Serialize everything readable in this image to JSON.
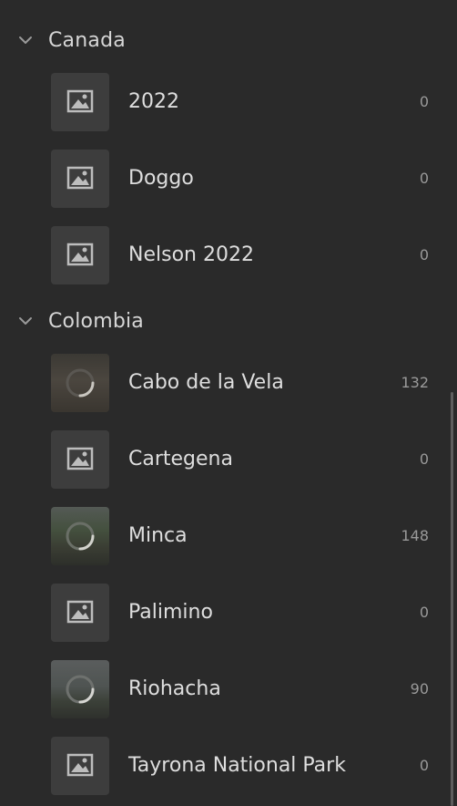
{
  "groups": [
    {
      "name": "Canada",
      "albums": [
        {
          "name": "2022",
          "count": "0",
          "thumb": "placeholder-image-icon"
        },
        {
          "name": "Doggo",
          "count": "0",
          "thumb": "placeholder-image-icon"
        },
        {
          "name": "Nelson 2022",
          "count": "0",
          "thumb": "placeholder-image-icon"
        }
      ]
    },
    {
      "name": "Colombia",
      "albums": [
        {
          "name": "Cabo de la Vela",
          "count": "132",
          "thumb": "loading-spinner-icon"
        },
        {
          "name": "Cartegena",
          "count": "0",
          "thumb": "placeholder-image-icon"
        },
        {
          "name": "Minca",
          "count": "148",
          "thumb": "loading-spinner-icon"
        },
        {
          "name": "Palimino",
          "count": "0",
          "thumb": "placeholder-image-icon"
        },
        {
          "name": "Riohacha",
          "count": "90",
          "thumb": "loading-spinner-icon"
        },
        {
          "name": "Tayrona National Park",
          "count": "0",
          "thumb": "placeholder-image-icon"
        }
      ]
    }
  ],
  "colors": {
    "background": "#2a2a2a",
    "thumb_placeholder": "#3d3d3d",
    "text": "#dedede",
    "count": "#9a9a9a"
  }
}
